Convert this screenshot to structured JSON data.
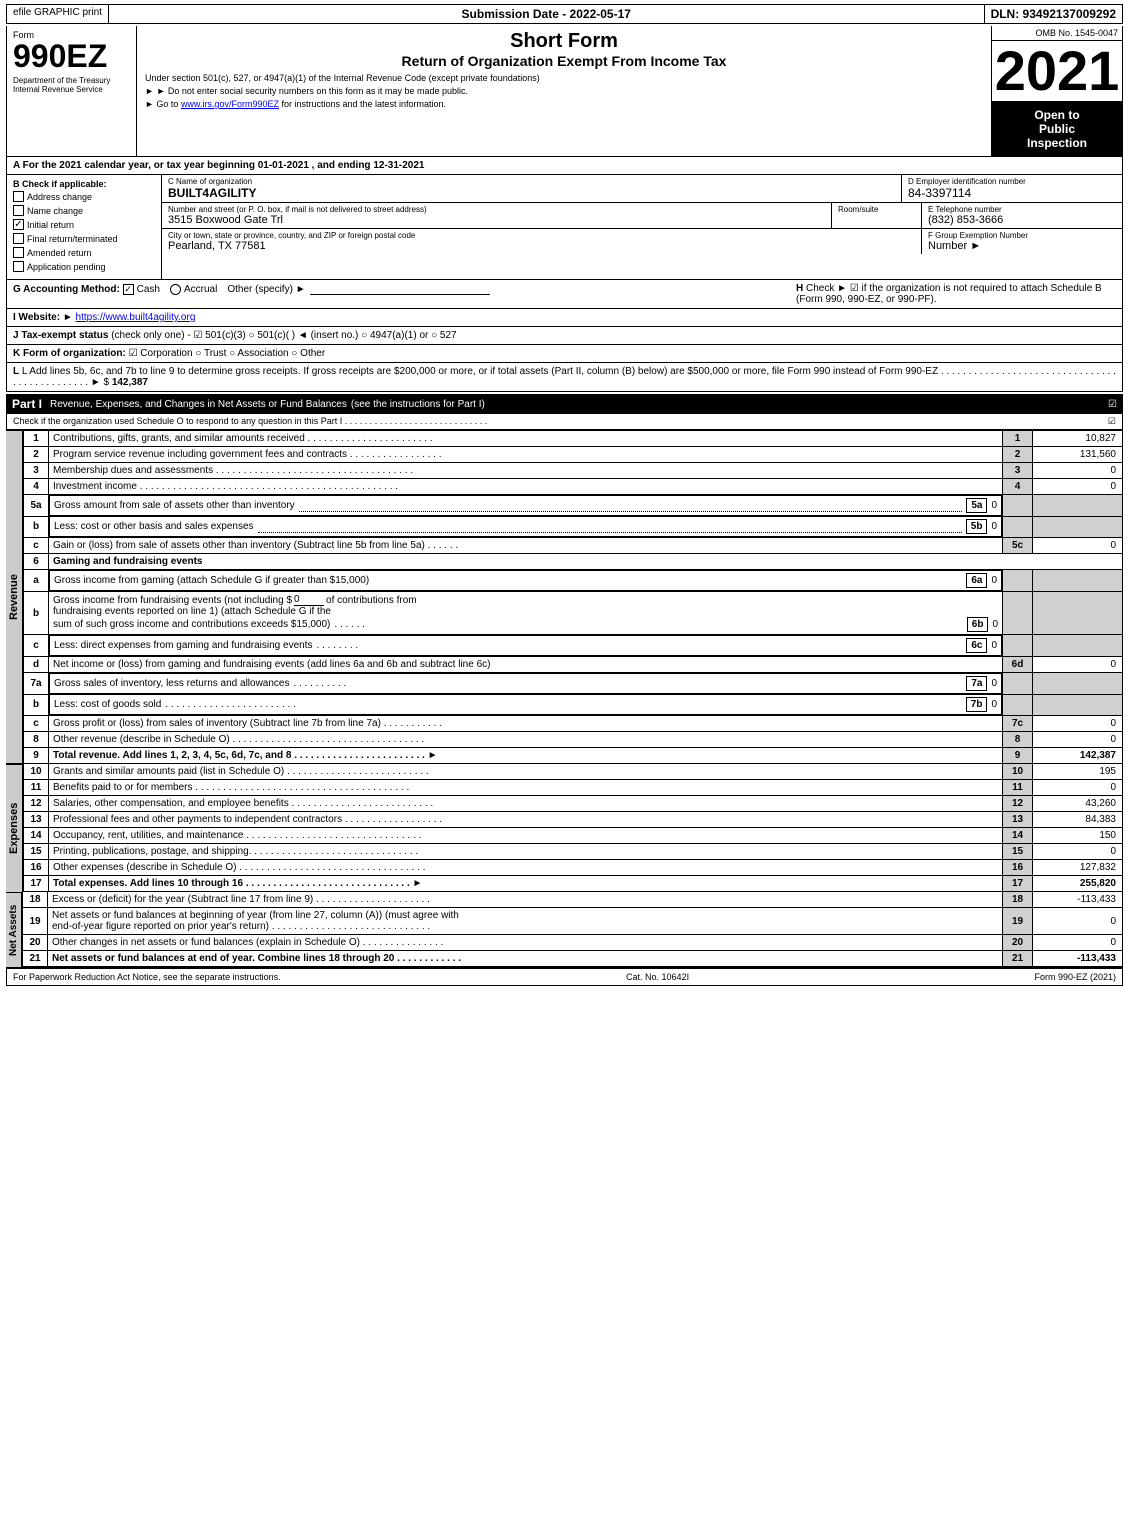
{
  "topBar": {
    "efile": "efile GRAPHIC print",
    "submissionLabel": "Submission Date - 2022-05-17",
    "dlnLabel": "DLN: 93492137009292"
  },
  "header": {
    "formNumber": "990EZ",
    "formDesc": "Department of the Treasury\nInternal Revenue Service",
    "shortForm": "Short Form",
    "returnTitle": "Return of Organization Exempt From Income Tax",
    "line1": "Under section 501(c), 527, or 4947(a)(1) of the Internal Revenue Code (except private foundations)",
    "line2": "► Do not enter social security numbers on this form as it may be made public.",
    "line3": "► Go to www.irs.gov/Form990EZ for instructions and the latest information.",
    "year": "2021",
    "ombNo": "OMB No. 1545-0047",
    "openToPublic": "Open to Public Inspection"
  },
  "sectionA": {
    "text": "A For the 2021 calendar year, or tax year beginning 01-01-2021 , and ending 12-31-2021"
  },
  "checkItems": {
    "label": "B Check if applicable:",
    "items": [
      {
        "id": "address-change",
        "label": "Address change",
        "checked": false
      },
      {
        "id": "name-change",
        "label": "Name change",
        "checked": false
      },
      {
        "id": "initial-return",
        "label": "Initial return",
        "checked": true
      },
      {
        "id": "final-return",
        "label": "Final return/terminated",
        "checked": false
      },
      {
        "id": "amended-return",
        "label": "Amended return",
        "checked": false
      },
      {
        "id": "application-pending",
        "label": "Application pending",
        "checked": false
      }
    ]
  },
  "orgInfo": {
    "cLabel": "C Name of organization",
    "orgName": "BUILT4AGILITY",
    "dLabel": "D Employer identification number",
    "ein": "84-3397114",
    "streetLabel": "Number and street (or P. O. box, if mail is not delivered to street address)",
    "street": "3515 Boxwood Gate Trl",
    "roomLabel": "Room/suite",
    "roomValue": "",
    "eLabel": "E Telephone number",
    "phone": "(832) 853-3666",
    "cityLabel": "City or town, state or province, country, and ZIP or foreign postal code",
    "city": "Pearland, TX  77581",
    "fLabel": "F Group Exemption Number",
    "groupNumber": "►"
  },
  "accounting": {
    "gLabel": "G Accounting Method:",
    "cash": "Cash",
    "accrual": "Accrual",
    "other": "Other (specify) ►",
    "hLabel": "H Check ►",
    "hText": "☑ if the organization is not required to attach Schedule B (Form 990, 990-EZ, or 990-PF)."
  },
  "website": {
    "iLabel": "I Website: ►",
    "url": "https://www.built4agility.org"
  },
  "taxStatus": {
    "jLabel": "J Tax-exempt status",
    "jText": "(check only one) - ☑ 501(c)(3) ○ 501(c)( ) ◄ (insert no.) ○ 4947(a)(1) or ○ 527"
  },
  "formOrg": {
    "kLabel": "K Form of organization:",
    "kText": "☑ Corporation  ○ Trust  ○ Association  ○ Other"
  },
  "lLine": {
    "text": "L Add lines 5b, 6c, and 7b to line 9 to determine gross receipts. If gross receipts are $200,000 or more, or if total assets (Part II, column (B) below) are $500,000 or more, file Form 990 instead of Form 990-EZ",
    "dots": ". . . . . . . . . . . . . . . . . . . . . . . . . . . . . . . . . . . . . . . . . . . . . . . . ► $",
    "value": "142,387"
  },
  "partI": {
    "label": "Part I",
    "title": "Revenue, Expenses, and Changes in Net Assets or Fund Balances",
    "note": "(see the instructions for Part I)",
    "checkLine": "Check if the organization used Schedule O to respond to any question in this Part I",
    "checkDots": ". . . . . . . . . . . . . . . . . . . . . . . . . . . ."
  },
  "revenueLines": [
    {
      "num": "1",
      "desc": "Contributions, gifts, grants, and similar amounts received",
      "dots": true,
      "lineRef": "1",
      "value": "10,827"
    },
    {
      "num": "2",
      "desc": "Program service revenue including government fees and contracts",
      "dots": true,
      "lineRef": "2",
      "value": "131,560"
    },
    {
      "num": "3",
      "desc": "Membership dues and assessments",
      "dots": true,
      "lineRef": "3",
      "value": "0"
    },
    {
      "num": "4",
      "desc": "Investment income",
      "dots": true,
      "lineRef": "4",
      "value": "0"
    },
    {
      "num": "5a",
      "desc": "Gross amount from sale of assets other than inventory",
      "dots2": true,
      "ref": "5a",
      "refValue": "0"
    },
    {
      "num": "b",
      "desc": "Less: cost or other basis and sales expenses",
      "dots2": true,
      "ref": "5b",
      "refValue": "0"
    },
    {
      "num": "c",
      "desc": "Gain or (loss) from sale of assets other than inventory (Subtract line 5b from line 5a)",
      "dots2": true,
      "lineRef": "5c",
      "value": "0"
    },
    {
      "num": "6",
      "desc": "Gaming and fundraising events",
      "isHeader": true
    },
    {
      "num": "a",
      "desc": "Gross income from gaming (attach Schedule G if greater than $15,000)",
      "ref": "6a",
      "refValue": "0"
    },
    {
      "num": "b",
      "desc": "Gross income from fundraising events (not including $",
      "bAmt": "0",
      "bText": "of contributions from fundraising events reported on line 1) (attach Schedule G if the sum of such gross income and contributions exceeds $15,000)",
      "ref": "6b",
      "refValue": "0"
    },
    {
      "num": "c",
      "desc": "Less: direct expenses from gaming and fundraising events",
      "dots2": true,
      "ref": "6c",
      "refValue": "0"
    },
    {
      "num": "d",
      "desc": "Net income or (loss) from gaming and fundraising events (add lines 6a and 6b and subtract line 6c)",
      "lineRef": "6d",
      "value": "0"
    },
    {
      "num": "7a",
      "desc": "Gross sales of inventory, less returns and allowances",
      "dots2": true,
      "ref": "7a",
      "refValue": "0"
    },
    {
      "num": "b",
      "desc": "Less: cost of goods sold",
      "dots2": true,
      "ref": "7b",
      "refValue": "0"
    },
    {
      "num": "c",
      "desc": "Gross profit or (loss) from sales of inventory (Subtract line 7b from line 7a)",
      "dots2": true,
      "lineRef": "7c",
      "value": "0"
    },
    {
      "num": "8",
      "desc": "Other revenue (describe in Schedule O)",
      "dots": true,
      "lineRef": "8",
      "value": "0"
    },
    {
      "num": "9",
      "desc": "Total revenue. Add lines 1, 2, 3, 4, 5c, 6d, 7c, and 8",
      "dots": true,
      "arrow": true,
      "lineRef": "9",
      "value": "142,387",
      "bold": true
    }
  ],
  "expenseLines": [
    {
      "num": "10",
      "desc": "Grants and similar amounts paid (list in Schedule O)",
      "dots": true,
      "lineRef": "10",
      "value": "195"
    },
    {
      "num": "11",
      "desc": "Benefits paid to or for members",
      "dots": true,
      "lineRef": "11",
      "value": "0"
    },
    {
      "num": "12",
      "desc": "Salaries, other compensation, and employee benefits",
      "dots": true,
      "lineRef": "12",
      "value": "43,260"
    },
    {
      "num": "13",
      "desc": "Professional fees and other payments to independent contractors",
      "dots": true,
      "lineRef": "13",
      "value": "84,383"
    },
    {
      "num": "14",
      "desc": "Occupancy, rent, utilities, and maintenance",
      "dots": true,
      "lineRef": "14",
      "value": "150"
    },
    {
      "num": "15",
      "desc": "Printing, publications, postage, and shipping",
      "dots": true,
      "lineRef": "15",
      "value": "0"
    },
    {
      "num": "16",
      "desc": "Other expenses (describe in Schedule O)",
      "dots": true,
      "lineRef": "16",
      "value": "127,832"
    },
    {
      "num": "17",
      "desc": "Total expenses. Add lines 10 through 16",
      "dots": true,
      "arrow": true,
      "lineRef": "17",
      "value": "255,820",
      "bold": true
    }
  ],
  "netAssetLines": [
    {
      "num": "18",
      "desc": "Excess or (deficit) for the year (Subtract line 17 from line 9)",
      "dots": true,
      "lineRef": "18",
      "value": "-113,433"
    },
    {
      "num": "19",
      "desc": "Net assets or fund balances at beginning of year (from line 27, column (A)) (must agree with end-of-year figure reported on prior year's return)",
      "dots": true,
      "lineRef": "19",
      "value": "0"
    },
    {
      "num": "20",
      "desc": "Other changes in net assets or fund balances (explain in Schedule O)",
      "dots": true,
      "lineRef": "20",
      "value": "0"
    },
    {
      "num": "21",
      "desc": "Net assets or fund balances at end of year. Combine lines 18 through 20",
      "dots": true,
      "lineRef": "21",
      "value": "-113,433",
      "bold": true
    }
  ],
  "footer": {
    "paperwork": "For Paperwork Reduction Act Notice, see the separate instructions.",
    "catNo": "Cat. No. 10642I",
    "formRef": "Form 990-EZ (2021)"
  }
}
